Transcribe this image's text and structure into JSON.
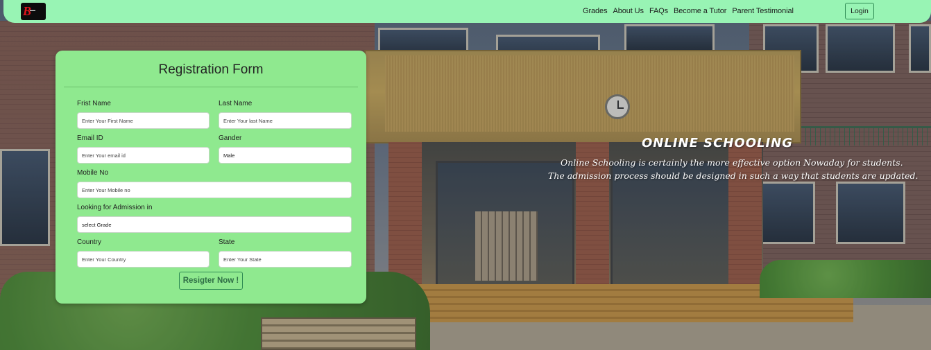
{
  "navbar": {
    "logo_icon": "school-logo-icon",
    "links": [
      "Grades",
      "About Us",
      "FAQs",
      "Become a Tutor",
      "Parent Testimonial"
    ],
    "login_label": "Login",
    "background_color": "#98f4b4"
  },
  "hero": {
    "title": "ONLINE SCHOOLING",
    "line1": "Online Schooling is certainly the more effective option Nowaday for students.",
    "line2": "The admission process should be designed in such a way that students are updated."
  },
  "form": {
    "title": "Registration Form",
    "background_color": "#8fe98f",
    "first_name": {
      "label": "Frist Name",
      "placeholder": "Enter  Your First Name"
    },
    "last_name": {
      "label": "Last Name",
      "placeholder": "Enter Your last Name"
    },
    "email": {
      "label": "Email ID",
      "placeholder": "Enter Your email id"
    },
    "gender": {
      "label": "Gander",
      "value": "Male"
    },
    "mobile": {
      "label": "Mobile No",
      "placeholder": "Enter Your Mobile no"
    },
    "admission": {
      "label": "Looking for Admission in",
      "value": "select Grade"
    },
    "country": {
      "label": "Country",
      "placeholder": "Enter Your Country"
    },
    "state": {
      "label": "State",
      "placeholder": "Enter Your State"
    },
    "submit_label": "Resigter Now !"
  }
}
